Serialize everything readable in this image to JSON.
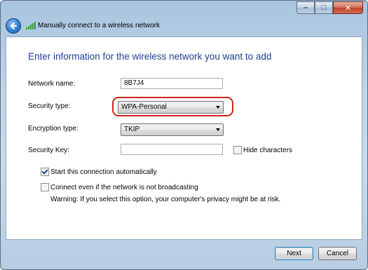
{
  "window": {
    "title": "Manually connect to a wireless network",
    "caption_buttons": {
      "minimize": "–",
      "maximize": "□",
      "close": "✕"
    }
  },
  "icons": {
    "back": "back-arrow-icon",
    "title": "wireless-signal-icon"
  },
  "colors": {
    "heading": "#1e3f8f",
    "highlight_ring": "#d0241b",
    "chrome": "#bcd3e8"
  },
  "page": {
    "heading": "Enter information for the wireless network you want to add",
    "network_name": {
      "label": "Network name:",
      "value": "8B7J4"
    },
    "security_type": {
      "label": "Security type:",
      "selected": "WPA-Personal"
    },
    "encryption_type": {
      "label": "Encryption type:",
      "selected": "TKIP"
    },
    "security_key": {
      "label": "Security Key:",
      "value": ""
    },
    "hide_characters": {
      "label": "Hide characters",
      "checked": false
    },
    "start_auto": {
      "label": "Start this connection automatically",
      "checked": true
    },
    "connect_even": {
      "label": "Connect even if the network is not broadcasting",
      "checked": false
    },
    "warning": "Warning: If you select this option, your computer's privacy might be at risk."
  },
  "footer": {
    "next": "Next",
    "cancel": "Cancel"
  }
}
